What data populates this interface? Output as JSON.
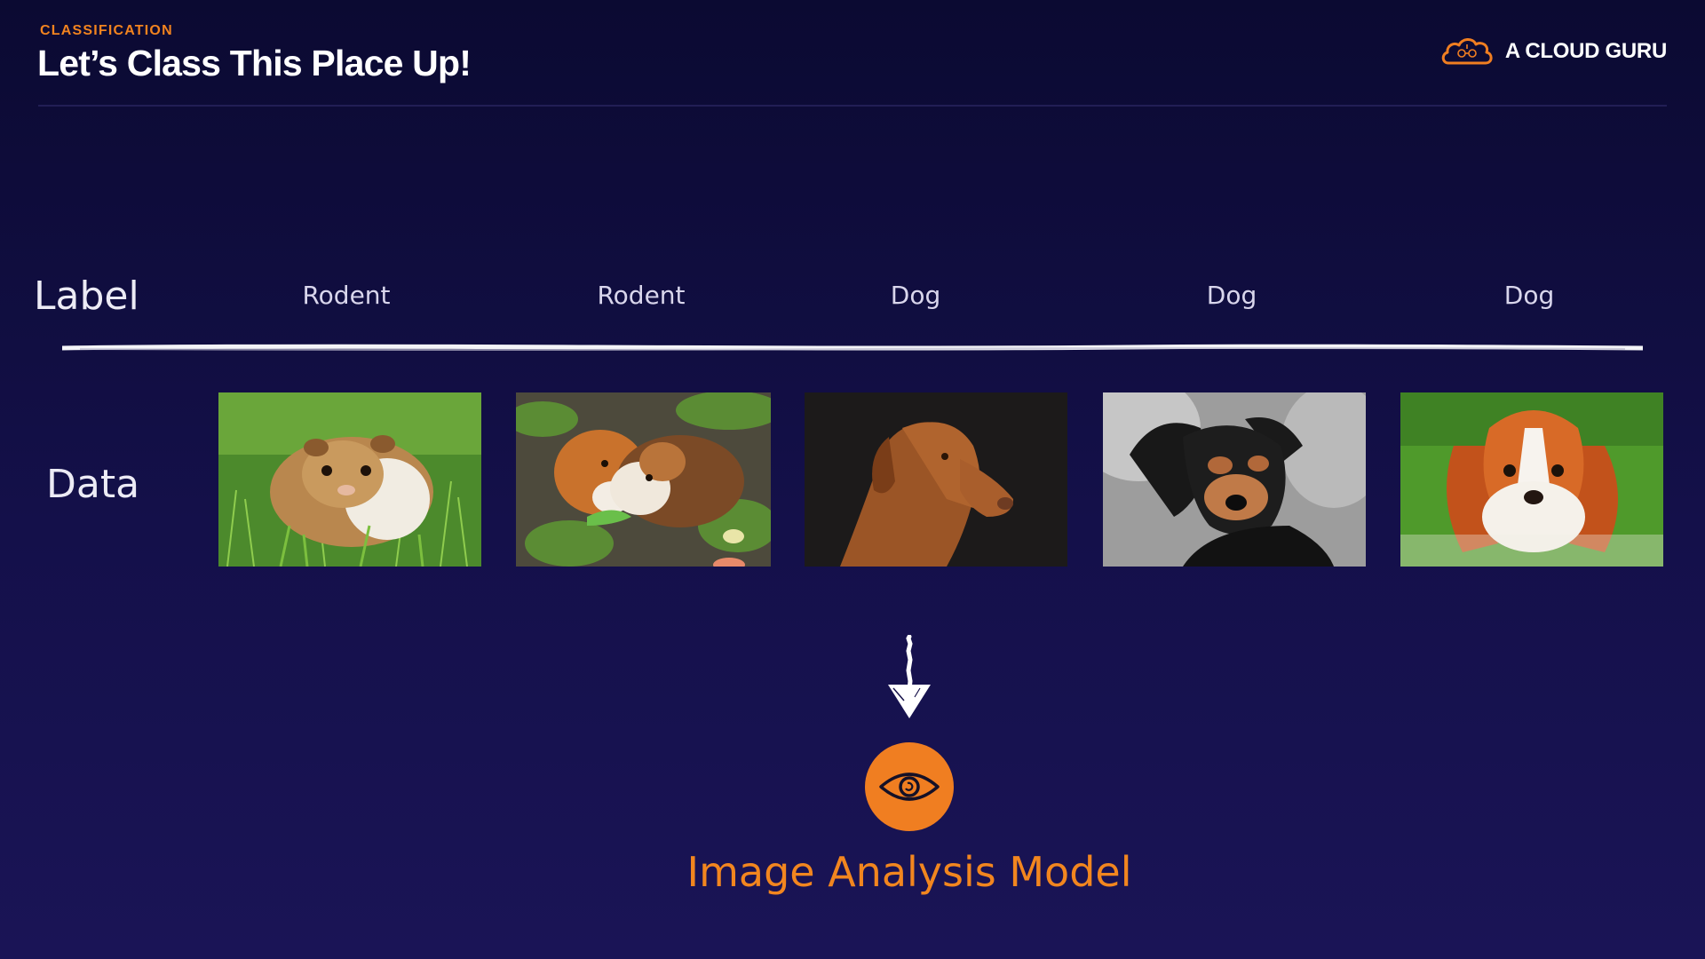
{
  "header": {
    "kicker": "CLASSIFICATION",
    "title": "Let’s Class This Place Up!",
    "brand_name": "A CLOUD GURU",
    "brand_icon": "cloud-logo-icon"
  },
  "rows": {
    "label_heading": "Label",
    "data_heading": "Data"
  },
  "items": [
    {
      "label": "Rodent",
      "image": "guinea-pig-in-grass"
    },
    {
      "label": "Rodent",
      "image": "two-guinea-pigs-eating"
    },
    {
      "label": "Dog",
      "image": "vizsla-portrait"
    },
    {
      "label": "Dog",
      "image": "black-and-tan-dog"
    },
    {
      "label": "Dog",
      "image": "cavalier-king-charles-spaniel"
    }
  ],
  "model": {
    "title": "Image Analysis Model",
    "icon": "eye-icon"
  },
  "colors": {
    "accent": "#f07e21",
    "background_top": "#0b0a32",
    "background_bottom": "#1a1456"
  }
}
